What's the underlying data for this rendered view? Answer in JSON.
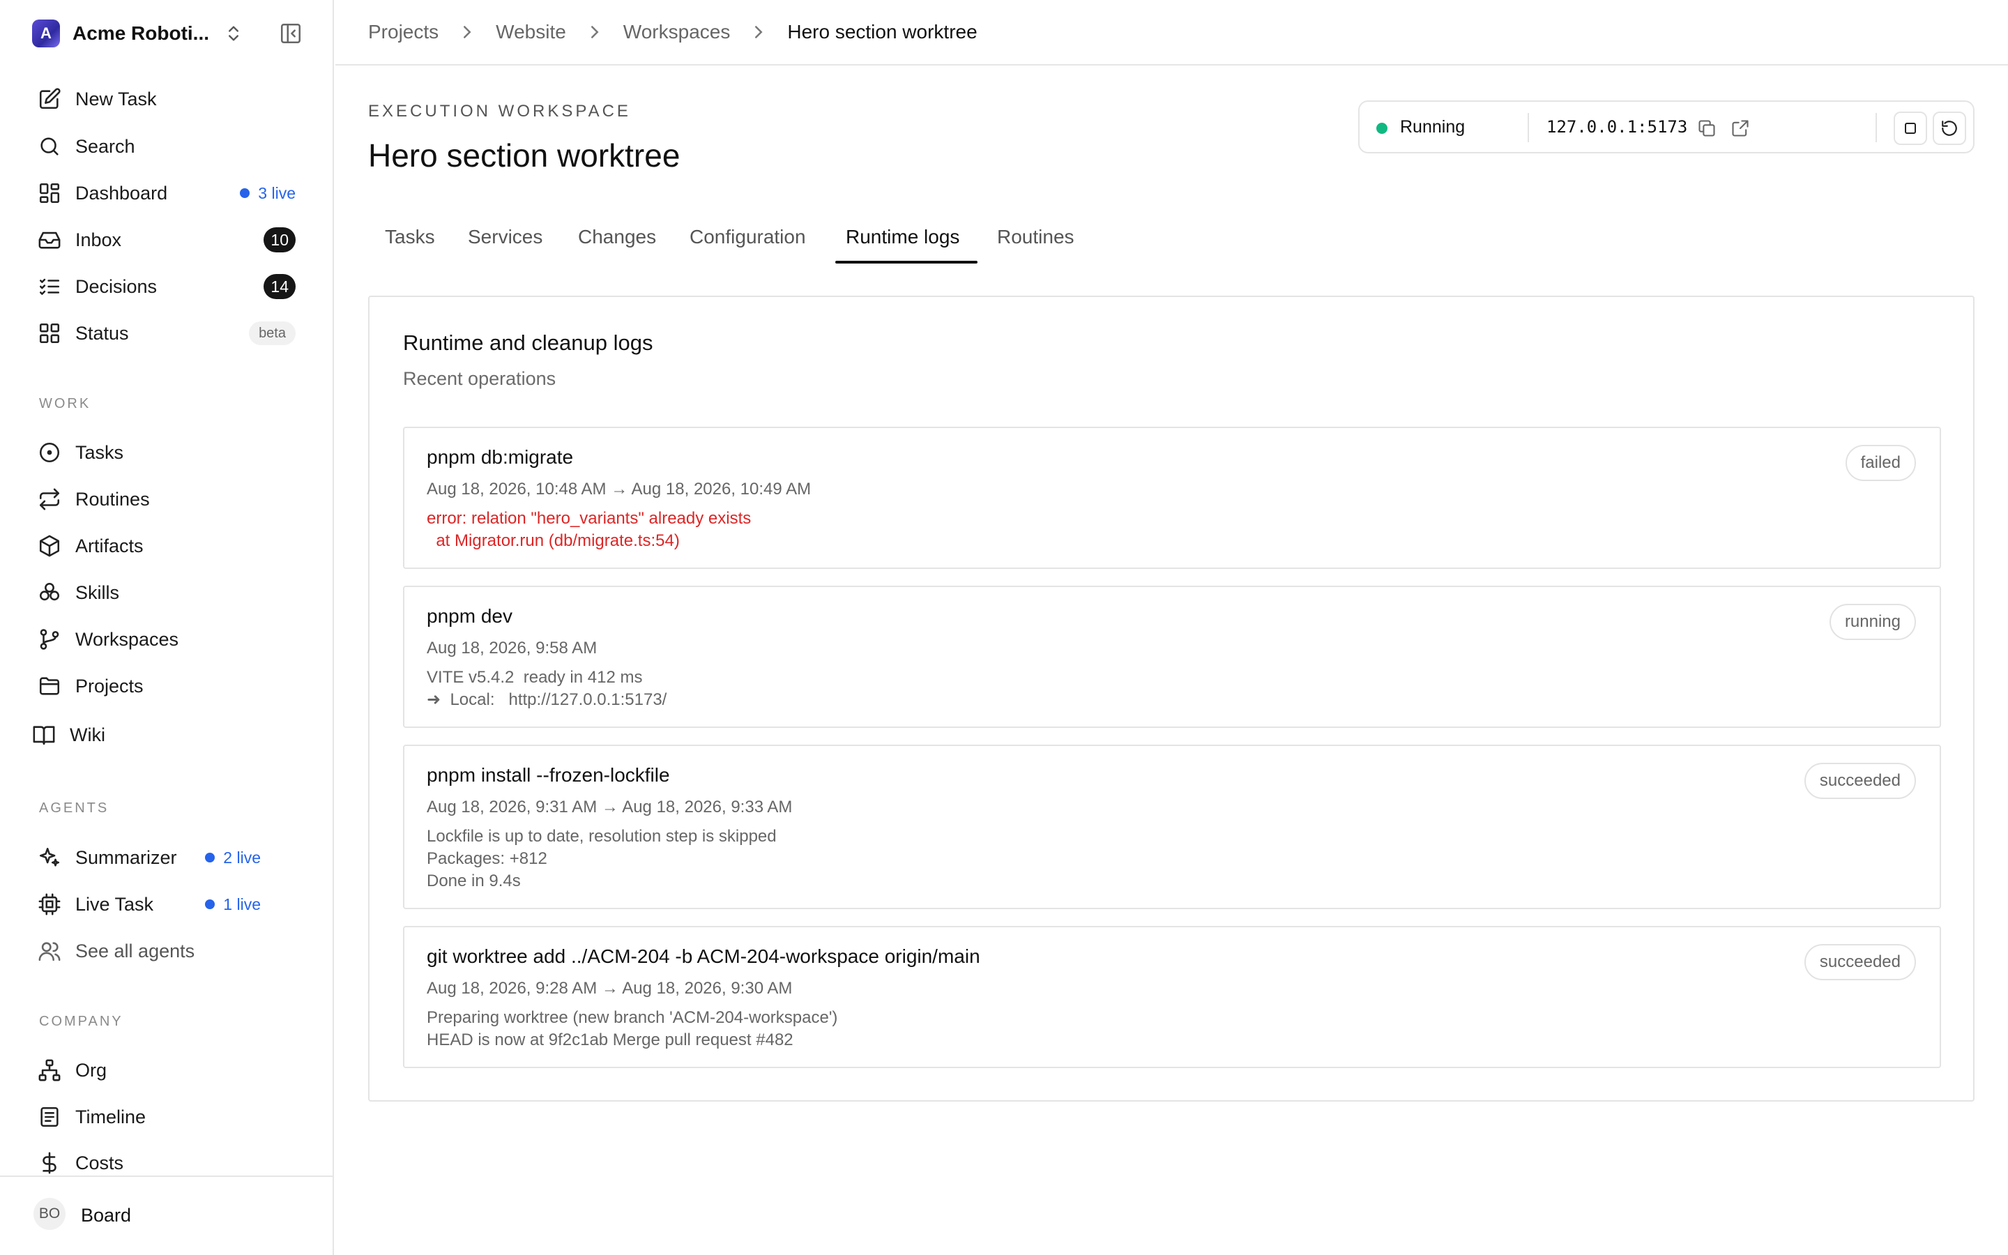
{
  "sidebar": {
    "company": {
      "initial": "A",
      "name": "Acme Roboti..."
    },
    "nav": [
      {
        "label": "New Task",
        "icon": "pencil-square-icon"
      },
      {
        "label": "Search",
        "icon": "search-icon"
      },
      {
        "label": "Dashboard",
        "icon": "dashboard-icon",
        "live": "3 live"
      },
      {
        "label": "Inbox",
        "icon": "inbox-icon",
        "count": "10"
      },
      {
        "label": "Decisions",
        "icon": "checklist-icon",
        "count": "14"
      },
      {
        "label": "Status",
        "icon": "grid-icon",
        "badge": "beta"
      }
    ],
    "work_label": "WORK",
    "work": [
      {
        "label": "Tasks",
        "icon": "circle-dot-icon"
      },
      {
        "label": "Routines",
        "icon": "repeat-icon"
      },
      {
        "label": "Artifacts",
        "icon": "box-icon"
      },
      {
        "label": "Skills",
        "icon": "skills-icon"
      },
      {
        "label": "Workspaces",
        "icon": "git-branch-icon"
      },
      {
        "label": "Projects",
        "icon": "folder-icon"
      },
      {
        "label": "Wiki",
        "icon": "book-icon"
      }
    ],
    "agents_label": "AGENTS",
    "agents": [
      {
        "label": "Summarizer",
        "icon": "sparkles-icon",
        "live": "2 live"
      },
      {
        "label": "Live Task",
        "icon": "cpu-icon",
        "live": "1 live"
      },
      {
        "label": "See all agents",
        "icon": "users-icon"
      }
    ],
    "company_label": "COMPANY",
    "company_items": [
      {
        "label": "Org",
        "icon": "org-chart-icon"
      },
      {
        "label": "Timeline",
        "icon": "timeline-icon"
      },
      {
        "label": "Costs",
        "icon": "dollar-icon"
      }
    ],
    "footer": {
      "initials": "BO",
      "name": "Board"
    }
  },
  "breadcrumb": [
    "Projects",
    "Website",
    "Workspaces",
    "Hero section worktree"
  ],
  "header": {
    "eyebrow": "EXECUTION WORKSPACE",
    "title": "Hero section worktree"
  },
  "status": {
    "state": "Running",
    "state_color": "#10b981",
    "address": "127.0.0.1:5173"
  },
  "tabs": [
    "Tasks",
    "Services",
    "Changes",
    "Configuration",
    "Runtime logs",
    "Routines"
  ],
  "active_tab": "Runtime logs",
  "logs_panel": {
    "title": "Runtime and cleanup logs",
    "subtitle": "Recent operations",
    "entries": [
      {
        "command": "pnpm db:migrate",
        "time": "Aug 18, 2026, 10:48 AM → Aug 18, 2026, 10:49 AM",
        "output": "error: relation \"hero_variants\" already exists\n  at Migrator.run (db/migrate.ts:54)",
        "status": "failed",
        "is_error": true
      },
      {
        "command": "pnpm dev",
        "time": "Aug 18, 2026, 9:58 AM",
        "output": "VITE v5.4.2  ready in 412 ms\n➜  Local:   http://127.0.0.1:5173/",
        "status": "running",
        "is_error": false
      },
      {
        "command": "pnpm install --frozen-lockfile",
        "time": "Aug 18, 2026, 9:31 AM → Aug 18, 2026, 9:33 AM",
        "output": "Lockfile is up to date, resolution step is skipped\nPackages: +812\nDone in 9.4s",
        "status": "succeeded",
        "is_error": false
      },
      {
        "command": "git worktree add ../ACM-204 -b ACM-204-workspace origin/main",
        "time": "Aug 18, 2026, 9:28 AM → Aug 18, 2026, 9:30 AM",
        "output": "Preparing worktree (new branch 'ACM-204-workspace')\nHEAD is now at 9f2c1ab Merge pull request #482",
        "status": "succeeded",
        "is_error": false
      }
    ]
  },
  "colors": {
    "accent_blue": "#2563eb",
    "error_red": "#dc2626",
    "success_green": "#10b981"
  }
}
